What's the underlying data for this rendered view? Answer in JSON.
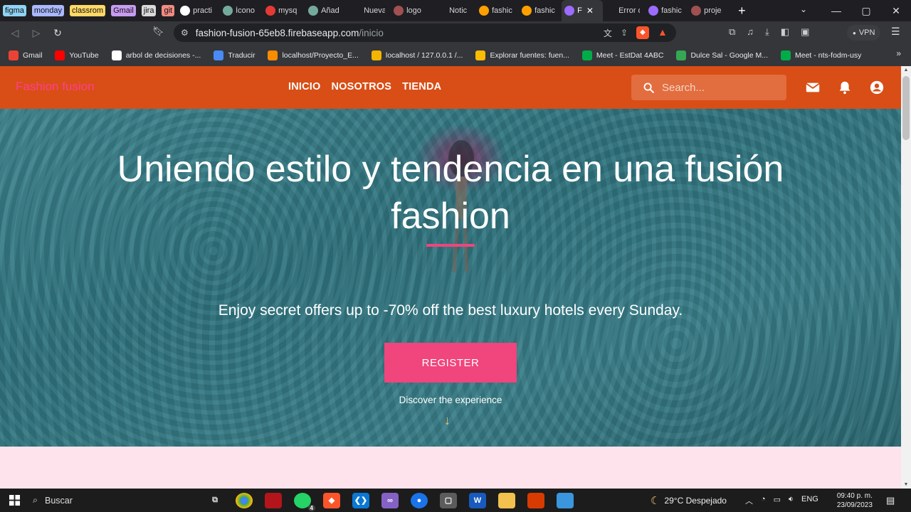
{
  "browser": {
    "tabs": [
      {
        "label": "figma",
        "chip": "#8fd3f4"
      },
      {
        "label": "monday",
        "chip": "#a9b8ff"
      },
      {
        "label": "classrom",
        "chip": "#ffd966"
      },
      {
        "label": "Gmail",
        "chip": "#c79bf2"
      },
      {
        "label": "jira",
        "chip": "#d9d9d9"
      },
      {
        "label": "git",
        "chip": "#f28b82"
      }
    ],
    "page_tabs": [
      {
        "title": "practi",
        "color": "#ffffff"
      },
      {
        "title": "Ícono",
        "color": "#74aa9c"
      },
      {
        "title": "mysq",
        "color": "#e53935"
      },
      {
        "title": "Añad",
        "color": "#74aa9c"
      },
      {
        "title": "Nueva pes",
        "color": "#1f1f23"
      },
      {
        "title": "logo",
        "color": "#a05050"
      },
      {
        "title": "Notic",
        "color": "#1f1f23"
      },
      {
        "title": "fashic",
        "color": "#ffa000"
      },
      {
        "title": "fashic",
        "color": "#ffa000"
      },
      {
        "title": "F",
        "color": "#9c6bff",
        "active": true
      },
      {
        "title": "Error de p",
        "color": "#1f1f23"
      },
      {
        "title": "fashic",
        "color": "#9c6bff"
      },
      {
        "title": "proje",
        "color": "#a05050"
      }
    ],
    "url_host": "fashion-fusion-65eb8.firebaseapp.com",
    "url_path": "/inicio",
    "vpn_label": "VPN",
    "bookmarks": [
      {
        "label": "Gmail",
        "color": "#ea4335"
      },
      {
        "label": "YouTube",
        "color": "#ff0000"
      },
      {
        "label": "arbol de decisiones -...",
        "color": "#ffffff"
      },
      {
        "label": "Traducir",
        "color": "#4a8af4"
      },
      {
        "label": "localhost/Proyecto_E...",
        "color": "#fb8c00"
      },
      {
        "label": "localhost / 127.0.0.1 /...",
        "color": "#f4b400"
      },
      {
        "label": "Explorar fuentes: fuen...",
        "color": "#fbbc04"
      },
      {
        "label": "Meet - EstDat 4ABC",
        "color": "#00ac47"
      },
      {
        "label": "Dulce Sal - Google M...",
        "color": "#34a853"
      },
      {
        "label": "Meet - nts-fodm-usy",
        "color": "#00ac47"
      }
    ]
  },
  "site": {
    "logo": "Fashion fusion",
    "nav": [
      "INICIO",
      "NOSOTROS",
      "TIENDA"
    ],
    "search_placeholder": "Search...",
    "hero_title": "Uniendo estilo y tendencia en una fusión fashion",
    "hero_subtitle": "Enjoy secret offers up to -70% off the best luxury hotels every Sunday.",
    "register_label": "REGISTER",
    "discover_label": "Discover the experience",
    "accent_color": "#f0457d",
    "header_color": "#d84e16"
  },
  "taskbar": {
    "search_label": "Buscar",
    "weather": "29°C  Despejado",
    "lang": "ENG",
    "time": "09:40 p. m.",
    "date": "23/09/2023",
    "whatsapp_badge": "4"
  }
}
